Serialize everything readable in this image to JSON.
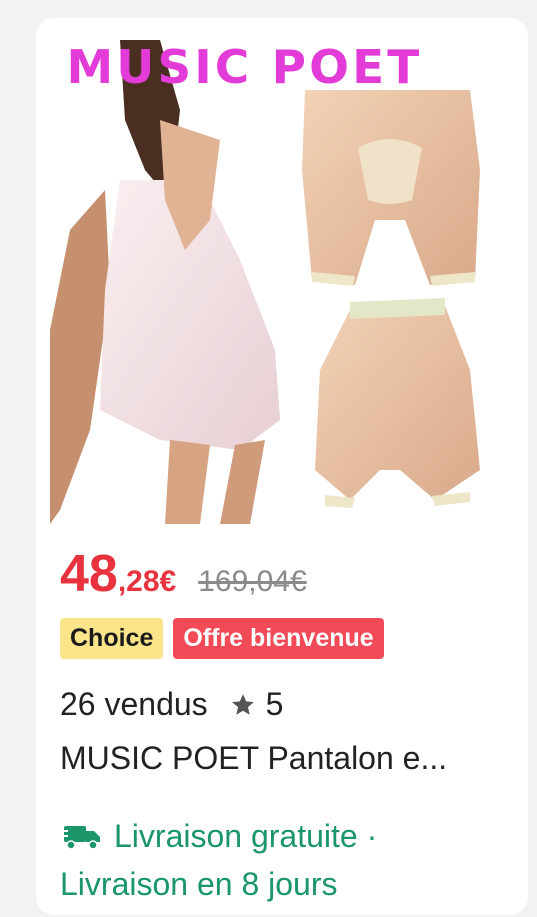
{
  "product": {
    "brand": "MUSIC POET",
    "price_integer": "48",
    "price_decimal": ",28€",
    "original_price": "169,04€",
    "badges": {
      "choice": "Choice",
      "offer": "Offre bienvenue"
    },
    "sold": "26 vendus",
    "rating": "5",
    "title": "MUSIC POET Pantalon e...",
    "shipping_free": "Livraison gratuite ·",
    "shipping_time": "Livraison en 8 jours"
  },
  "icons": {
    "star": "star-icon",
    "truck": "truck-icon"
  },
  "colors": {
    "price": "#e8333f",
    "choice_badge": "#fbe48a",
    "offer_badge": "#f24b57",
    "shipping": "#1a9668",
    "brand_logo": "#e23bd8"
  }
}
